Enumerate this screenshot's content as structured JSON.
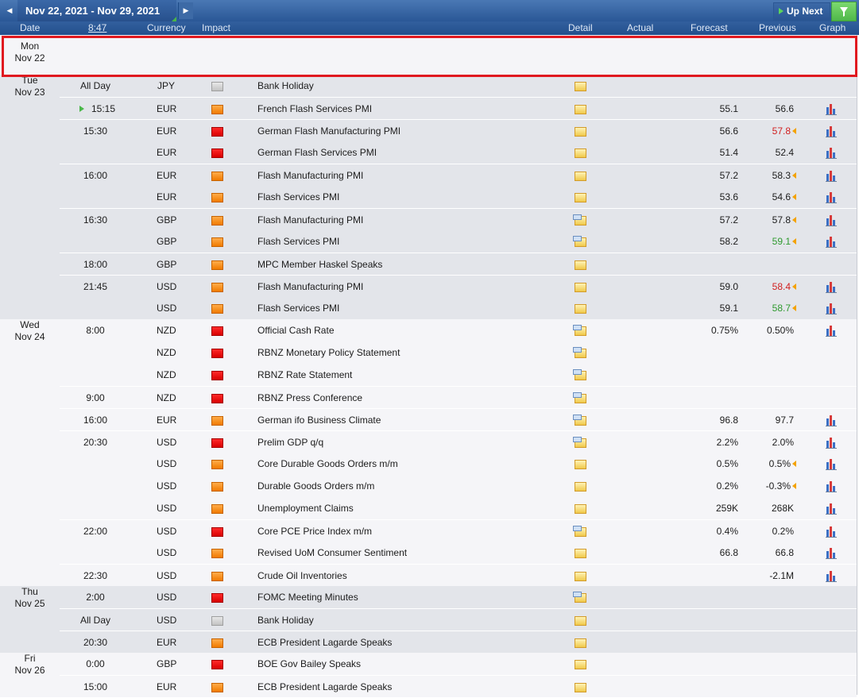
{
  "toolbar": {
    "date_range": "Nov 22, 2021 - Nov 29, 2021",
    "up_next_label": "Up Next",
    "prev_icon": "◀",
    "next_icon": "▶"
  },
  "columns": {
    "date": "Date",
    "time": "8:47",
    "currency": "Currency",
    "impact": "Impact",
    "detail": "Detail",
    "actual": "Actual",
    "forecast": "Forecast",
    "previous": "Previous",
    "graph": "Graph"
  },
  "days": [
    {
      "weekday": "Mon",
      "date": "Nov 22",
      "events": []
    },
    {
      "weekday": "Tue",
      "date": "Nov 23",
      "events": [
        {
          "time": "All Day",
          "currency": "JPY",
          "impact": "low",
          "event": "Bank Holiday",
          "detail_type": "plain",
          "forecast": "",
          "previous": "",
          "revised": false,
          "prev_color": "normal",
          "graph": false
        },
        {
          "time": "15:15",
          "currency": "EUR",
          "impact": "medium",
          "event": "French Flash Services PMI",
          "detail_type": "plain",
          "forecast": "55.1",
          "previous": "56.6",
          "revised": false,
          "prev_color": "normal",
          "graph": true,
          "next_up": true
        },
        {
          "time": "15:30",
          "currency": "EUR",
          "impact": "high",
          "event": "German Flash Manufacturing PMI",
          "detail_type": "plain",
          "forecast": "56.6",
          "previous": "57.8",
          "revised": true,
          "prev_color": "red",
          "graph": true
        },
        {
          "time": "",
          "currency": "EUR",
          "impact": "high",
          "event": "German Flash Services PMI",
          "detail_type": "plain",
          "forecast": "51.4",
          "previous": "52.4",
          "revised": false,
          "prev_color": "normal",
          "graph": true
        },
        {
          "time": "16:00",
          "currency": "EUR",
          "impact": "medium",
          "event": "Flash Manufacturing PMI",
          "detail_type": "plain",
          "forecast": "57.2",
          "previous": "58.3",
          "revised": true,
          "prev_color": "normal",
          "graph": true
        },
        {
          "time": "",
          "currency": "EUR",
          "impact": "medium",
          "event": "Flash Services PMI",
          "detail_type": "plain",
          "forecast": "53.6",
          "previous": "54.6",
          "revised": true,
          "prev_color": "normal",
          "graph": true
        },
        {
          "time": "16:30",
          "currency": "GBP",
          "impact": "medium",
          "event": "Flash Manufacturing PMI",
          "detail_type": "pub",
          "forecast": "57.2",
          "previous": "57.8",
          "revised": true,
          "prev_color": "normal",
          "graph": true
        },
        {
          "time": "",
          "currency": "GBP",
          "impact": "medium",
          "event": "Flash Services PMI",
          "detail_type": "pub",
          "forecast": "58.2",
          "previous": "59.1",
          "revised": true,
          "prev_color": "green",
          "graph": true
        },
        {
          "time": "18:00",
          "currency": "GBP",
          "impact": "medium",
          "event": "MPC Member Haskel Speaks",
          "detail_type": "plain",
          "forecast": "",
          "previous": "",
          "revised": false,
          "prev_color": "normal",
          "graph": false
        },
        {
          "time": "21:45",
          "currency": "USD",
          "impact": "medium",
          "event": "Flash Manufacturing PMI",
          "detail_type": "plain",
          "forecast": "59.0",
          "previous": "58.4",
          "revised": true,
          "prev_color": "red",
          "graph": true
        },
        {
          "time": "",
          "currency": "USD",
          "impact": "medium",
          "event": "Flash Services PMI",
          "detail_type": "plain",
          "forecast": "59.1",
          "previous": "58.7",
          "revised": true,
          "prev_color": "green",
          "graph": true
        }
      ]
    },
    {
      "weekday": "Wed",
      "date": "Nov 24",
      "events": [
        {
          "time": "8:00",
          "currency": "NZD",
          "impact": "high",
          "event": "Official Cash Rate",
          "detail_type": "pub",
          "forecast": "0.75%",
          "previous": "0.50%",
          "revised": false,
          "prev_color": "normal",
          "graph": true
        },
        {
          "time": "",
          "currency": "NZD",
          "impact": "high",
          "event": "RBNZ Monetary Policy Statement",
          "detail_type": "pub",
          "forecast": "",
          "previous": "",
          "revised": false,
          "prev_color": "normal",
          "graph": false
        },
        {
          "time": "",
          "currency": "NZD",
          "impact": "high",
          "event": "RBNZ Rate Statement",
          "detail_type": "pub",
          "forecast": "",
          "previous": "",
          "revised": false,
          "prev_color": "normal",
          "graph": false
        },
        {
          "time": "9:00",
          "currency": "NZD",
          "impact": "high",
          "event": "RBNZ Press Conference",
          "detail_type": "pub",
          "forecast": "",
          "previous": "",
          "revised": false,
          "prev_color": "normal",
          "graph": false
        },
        {
          "time": "16:00",
          "currency": "EUR",
          "impact": "medium",
          "event": "German ifo Business Climate",
          "detail_type": "pub",
          "forecast": "96.8",
          "previous": "97.7",
          "revised": false,
          "prev_color": "normal",
          "graph": true
        },
        {
          "time": "20:30",
          "currency": "USD",
          "impact": "high",
          "event": "Prelim GDP q/q",
          "detail_type": "pub",
          "forecast": "2.2%",
          "previous": "2.0%",
          "revised": false,
          "prev_color": "normal",
          "graph": true
        },
        {
          "time": "",
          "currency": "USD",
          "impact": "medium",
          "event": "Core Durable Goods Orders m/m",
          "detail_type": "plain",
          "forecast": "0.5%",
          "previous": "0.5%",
          "revised": true,
          "prev_color": "normal",
          "graph": true
        },
        {
          "time": "",
          "currency": "USD",
          "impact": "medium",
          "event": "Durable Goods Orders m/m",
          "detail_type": "plain",
          "forecast": "0.2%",
          "previous": "-0.3%",
          "revised": true,
          "prev_color": "normal",
          "graph": true
        },
        {
          "time": "",
          "currency": "USD",
          "impact": "medium",
          "event": "Unemployment Claims",
          "detail_type": "plain",
          "forecast": "259K",
          "previous": "268K",
          "revised": false,
          "prev_color": "normal",
          "graph": true
        },
        {
          "time": "22:00",
          "currency": "USD",
          "impact": "high",
          "event": "Core PCE Price Index m/m",
          "detail_type": "pub",
          "forecast": "0.4%",
          "previous": "0.2%",
          "revised": false,
          "prev_color": "normal",
          "graph": true
        },
        {
          "time": "",
          "currency": "USD",
          "impact": "medium",
          "event": "Revised UoM Consumer Sentiment",
          "detail_type": "plain",
          "forecast": "66.8",
          "previous": "66.8",
          "revised": false,
          "prev_color": "normal",
          "graph": true
        },
        {
          "time": "22:30",
          "currency": "USD",
          "impact": "medium",
          "event": "Crude Oil Inventories",
          "detail_type": "plain",
          "forecast": "",
          "previous": "-2.1M",
          "revised": false,
          "prev_color": "normal",
          "graph": true
        }
      ]
    },
    {
      "weekday": "Thu",
      "date": "Nov 25",
      "events": [
        {
          "time": "2:00",
          "currency": "USD",
          "impact": "high",
          "event": "FOMC Meeting Minutes",
          "detail_type": "pub",
          "forecast": "",
          "previous": "",
          "revised": false,
          "prev_color": "normal",
          "graph": false
        },
        {
          "time": "All Day",
          "currency": "USD",
          "impact": "low",
          "event": "Bank Holiday",
          "detail_type": "plain",
          "forecast": "",
          "previous": "",
          "revised": false,
          "prev_color": "normal",
          "graph": false
        },
        {
          "time": "20:30",
          "currency": "EUR",
          "impact": "medium",
          "event": "ECB President Lagarde Speaks",
          "detail_type": "plain",
          "forecast": "",
          "previous": "",
          "revised": false,
          "prev_color": "normal",
          "graph": false
        }
      ]
    },
    {
      "weekday": "Fri",
      "date": "Nov 26",
      "events": [
        {
          "time": "0:00",
          "currency": "GBP",
          "impact": "high",
          "event": "BOE Gov Bailey Speaks",
          "detail_type": "plain",
          "forecast": "",
          "previous": "",
          "revised": false,
          "prev_color": "normal",
          "graph": false
        },
        {
          "time": "15:00",
          "currency": "EUR",
          "impact": "medium",
          "event": "ECB President Lagarde Speaks",
          "detail_type": "plain",
          "forecast": "",
          "previous": "",
          "revised": false,
          "prev_color": "normal",
          "graph": false
        }
      ]
    }
  ],
  "colors": {
    "high_impact": "#e00000",
    "medium_impact": "#f58a00",
    "low_impact": "#c8c8c8",
    "worse_than_forecast": "#d11f1f",
    "better_than_forecast": "#2f9a2f",
    "highlight_box": "#e0191f"
  }
}
